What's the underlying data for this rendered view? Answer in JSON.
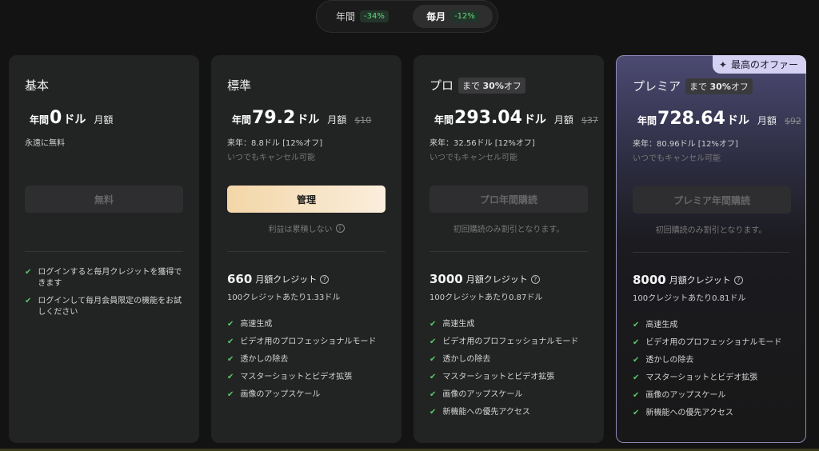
{
  "toggle": {
    "yearly": {
      "label": "年間",
      "badge": "-34%"
    },
    "monthly": {
      "label": "毎月",
      "badge": "-12%"
    }
  },
  "colors": {
    "accent_check": "#59c96a",
    "cta_active_start": "#f3d6a7",
    "premier_border": "#8e89b8",
    "offer_badge_bg": "#d5d1f2"
  },
  "plans": [
    {
      "name": "基本",
      "price_prefix": "年間",
      "price_amount": "0",
      "price_unit": "ドル",
      "price_suffix": "月額",
      "sub1": "永遠に無料",
      "cta": "無料",
      "features": [
        "ログインすると毎月クレジットを獲得できます",
        "ログインして毎月会員限定の機能をお試しください"
      ]
    },
    {
      "name": "標準",
      "price_prefix": "年間",
      "price_amount": "79.2",
      "price_unit": "ドル",
      "price_suffix": "月額",
      "price_strike": "$10",
      "sub1": "来年：8.8ドル [12%オフ]",
      "sub2": "いつでもキャンセル可能",
      "cta": "管理",
      "note": "利益は累積しない",
      "credits_num": "660",
      "credits_label": "月額クレジット",
      "per_credit": "100クレジットあたり1.33ドル",
      "features": [
        "高速生成",
        "ビデオ用のプロフェッショナルモード",
        "透かしの除去",
        "マスターショットとビデオ拡張",
        "画像のアップスケール"
      ]
    },
    {
      "name": "プロ",
      "badge_pre": "まで",
      "badge_pct": "30%",
      "badge_post": "オフ",
      "price_prefix": "年間",
      "price_amount": "293.04",
      "price_unit": "ドル",
      "price_suffix": "月額",
      "price_strike": "$37",
      "sub1": "来年：32.56ドル [12%オフ]",
      "sub2": "いつでもキャンセル可能",
      "cta": "プロ年間購読",
      "note": "初回購読のみ割引となります。",
      "credits_num": "3000",
      "credits_label": "月額クレジット",
      "per_credit": "100クレジットあたり0.87ドル",
      "features": [
        "高速生成",
        "ビデオ用のプロフェッショナルモード",
        "透かしの除去",
        "マスターショットとビデオ拡張",
        "画像のアップスケール",
        "新機能への優先アクセス"
      ]
    },
    {
      "name": "プレミア",
      "badge_pre": "まで",
      "badge_pct": "30%",
      "badge_post": "オフ",
      "offer": "最高のオファー",
      "price_prefix": "年間",
      "price_amount": "728.64",
      "price_unit": "ドル",
      "price_suffix": "月額",
      "price_strike": "$92",
      "sub1": "来年：80.96ドル [12%オフ]",
      "sub2": "いつでもキャンセル可能",
      "cta": "プレミア年間購読",
      "note": "初回購読のみ割引となります。",
      "credits_num": "8000",
      "credits_label": "月額クレジット",
      "per_credit": "100クレジットあたり0.81ドル",
      "features": [
        "高速生成",
        "ビデオ用のプロフェッショナルモード",
        "透かしの除去",
        "マスターショットとビデオ拡張",
        "画像のアップスケール",
        "新機能への優先アクセス"
      ]
    }
  ]
}
